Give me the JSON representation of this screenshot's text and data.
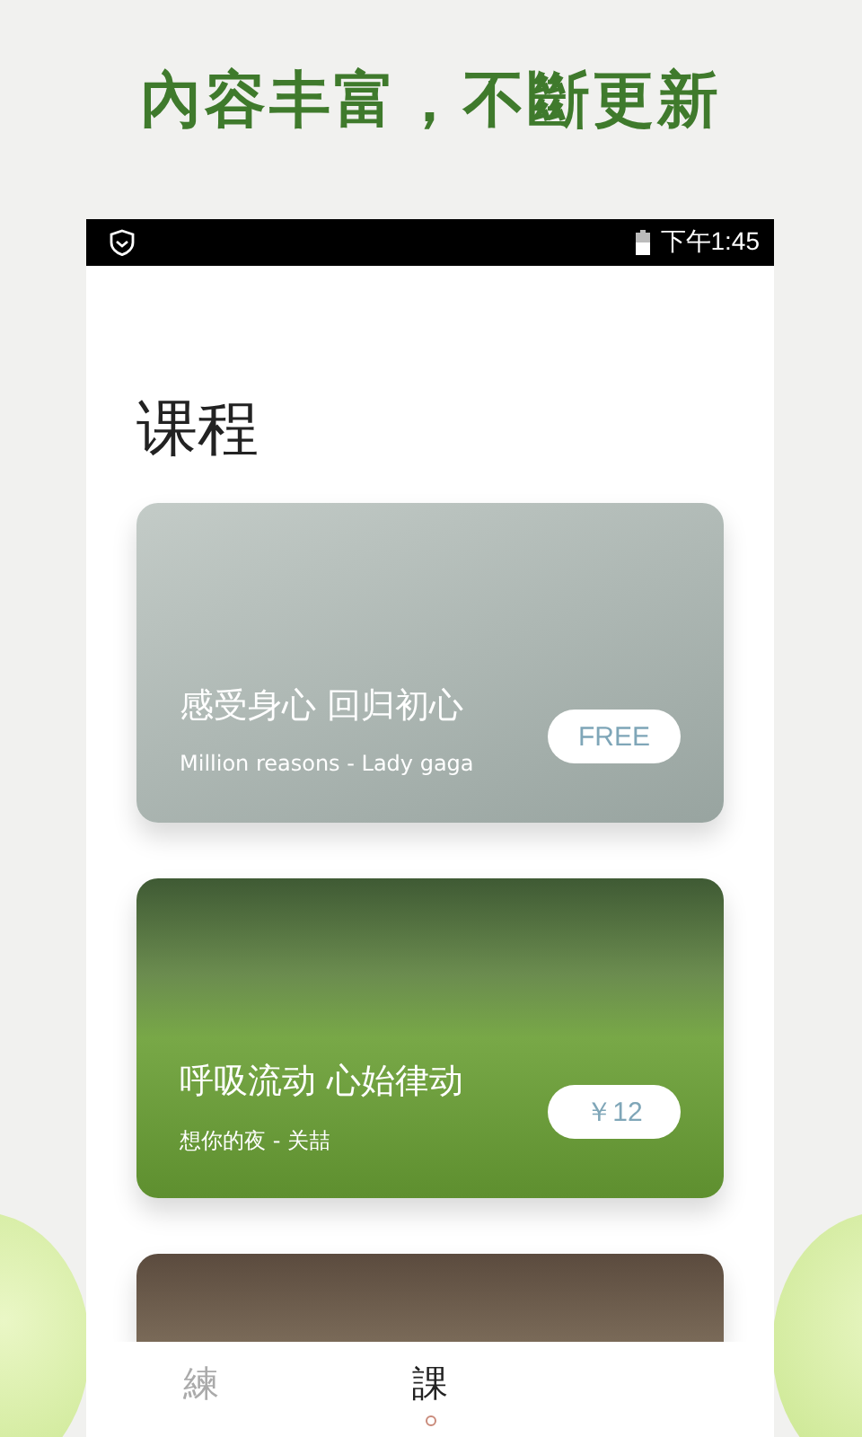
{
  "headline": "內容丰富，不斷更新",
  "status_bar": {
    "time": "下午1:45"
  },
  "page_title": "课程",
  "courses": [
    {
      "title": "感受身心 回归初心",
      "music": "Million reasons - Lady gaga",
      "price": "FREE",
      "kind": "studio"
    },
    {
      "title": "呼吸流动 心始律动",
      "music": "想你的夜 - 关喆",
      "price": "￥12",
      "kind": "lawn"
    },
    {
      "kind": "forest"
    }
  ],
  "tabs": [
    {
      "label": "練",
      "selected": false
    },
    {
      "label": "課",
      "selected": true
    }
  ]
}
